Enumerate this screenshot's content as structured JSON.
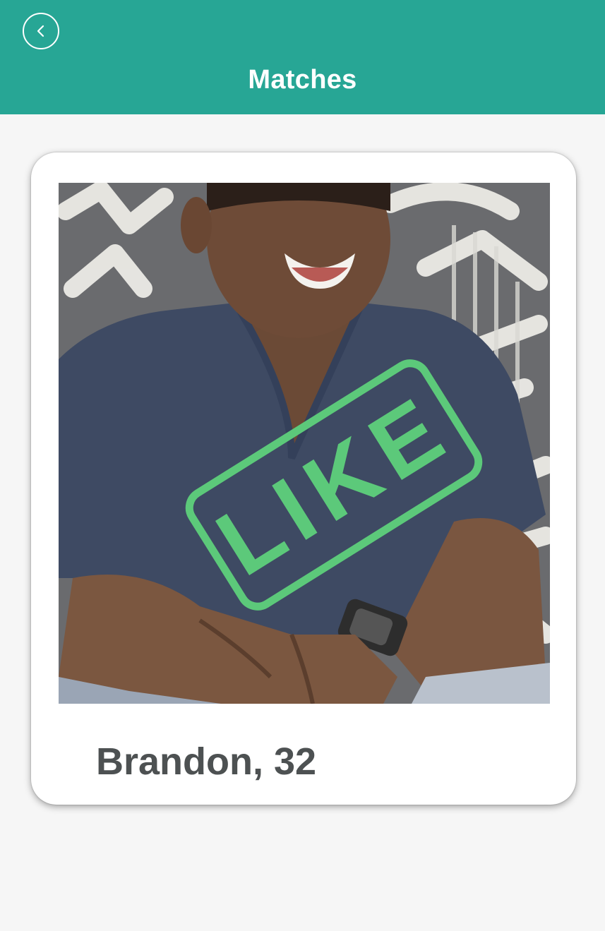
{
  "header": {
    "title": "Matches",
    "back_icon": "chevron-left-icon",
    "background_color": "#27a695"
  },
  "card": {
    "photo_alt": "profile-photo",
    "stamp_text": "LIKE",
    "stamp_color": "#5cc97a",
    "name_age": "Brandon, 32"
  }
}
